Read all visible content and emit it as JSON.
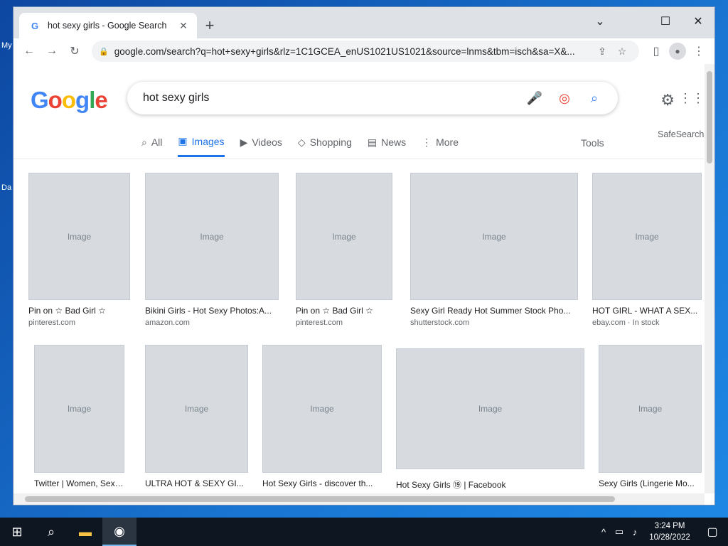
{
  "desktop": {
    "label_1": "My",
    "label_2": "Da"
  },
  "browser": {
    "tab_title": "hot sexy girls - Google Search",
    "new_tab": "+",
    "minimize": "⌄",
    "restore": "☐",
    "close": "✕",
    "url": "google.com/search?q=hot+sexy+girls&rlz=1C1GCEA_enUS1021US1021&source=lnms&tbm=isch&sa=X&..."
  },
  "search": {
    "logo": "Google",
    "query": "hot sexy girls",
    "tabs": [
      {
        "label": "All"
      },
      {
        "label": "Images"
      },
      {
        "label": "Videos"
      },
      {
        "label": "Shopping"
      },
      {
        "label": "News"
      },
      {
        "label": "More"
      }
    ],
    "tools": "Tools",
    "safesearch": "SafeSearch"
  },
  "results": [
    {
      "title": "Pin on ☆ Bad Girl ☆",
      "source": "pinterest.com"
    },
    {
      "title": "Bikini Girls - Hot Sexy Photos:A...",
      "source": "amazon.com"
    },
    {
      "title": "Pin on ☆ Bad Girl ☆",
      "source": "pinterest.com"
    },
    {
      "title": "Sexy Girl Ready Hot Summer Stock Pho...",
      "source": "shutterstock.com"
    },
    {
      "title": "HOT GIRL - WHAT A SEX...",
      "source": "ebay.com · In stock"
    },
    {
      "title": "Twitter | Women, Sexy ...",
      "source": ""
    },
    {
      "title": "ULTRA HOT & SEXY GI...",
      "source": ""
    },
    {
      "title": "Hot Sexy Girls - discover th...",
      "source": ""
    },
    {
      "title": "Hot Sexy Girls ⑲ | Facebook",
      "source": ""
    },
    {
      "title": "Sexy Girls (Lingerie Mo...",
      "source": ""
    }
  ],
  "taskbar": {
    "time": "3:24 PM",
    "date": "10/28/2022"
  }
}
